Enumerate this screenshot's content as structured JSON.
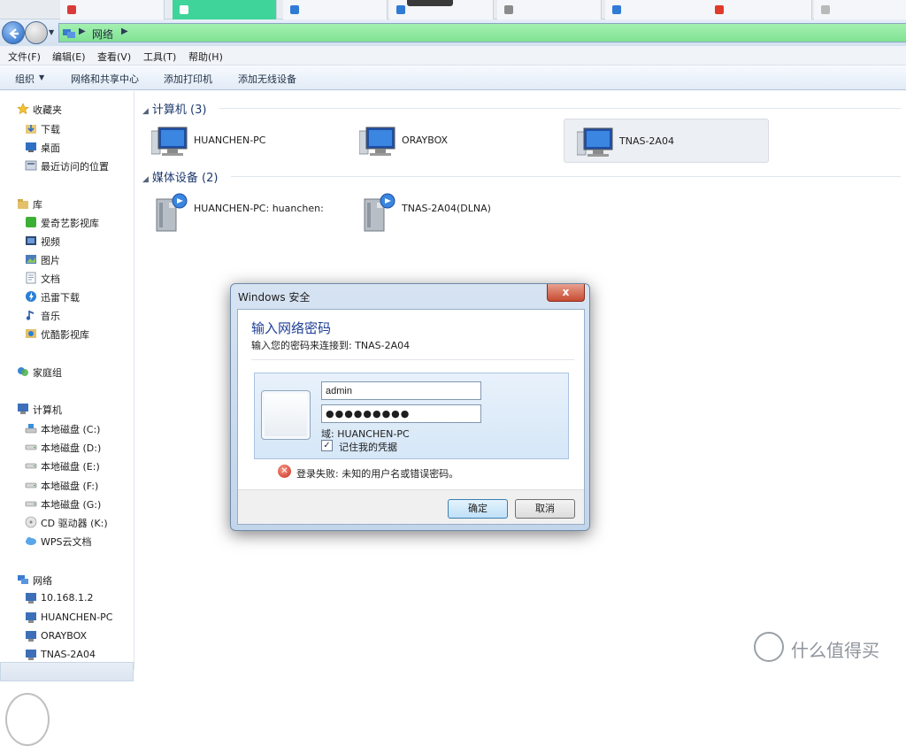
{
  "address": {
    "crumb": "网络"
  },
  "menubar": [
    "文件(F)",
    "编辑(E)",
    "查看(V)",
    "工具(T)",
    "帮助(H)"
  ],
  "toolbar": {
    "organize": "组织",
    "network_center": "网络和共享中心",
    "add_printer": "添加打印机",
    "add_wireless": "添加无线设备"
  },
  "sidebar": {
    "favorites": "收藏夹",
    "fav_items": [
      "下载",
      "桌面",
      "最近访问的位置"
    ],
    "libraries": "库",
    "lib_items": [
      "爱奇艺影视库",
      "视频",
      "图片",
      "文档",
      "迅雷下载",
      "音乐",
      "优酷影视库"
    ],
    "homegroup": "家庭组",
    "computer": "计算机",
    "drives": [
      "本地磁盘 (C:)",
      "本地磁盘 (D:)",
      "本地磁盘 (E:)",
      "本地磁盘 (F:)",
      "本地磁盘 (G:)",
      "CD 驱动器 (K:)",
      "WPS云文档"
    ],
    "network": "网络",
    "net_items": [
      "10.168.1.2",
      "HUANCHEN-PC",
      "ORAYBOX",
      "TNAS-2A04"
    ]
  },
  "content": {
    "computers_group": "计算机 (3)",
    "computers": [
      "HUANCHEN-PC",
      "ORAYBOX",
      "TNAS-2A04"
    ],
    "media_group": "媒体设备 (2)",
    "media": [
      "HUANCHEN-PC: huanchen:",
      "TNAS-2A04(DLNA)"
    ]
  },
  "dialog": {
    "title": "Windows 安全",
    "close": "x",
    "heading": "输入网络密码",
    "subtitle": "输入您的密码来连接到: TNAS-2A04",
    "username": "admin",
    "password": "●●●●●●●●●",
    "domain": "域: HUANCHEN-PC",
    "remember": "记住我的凭据",
    "remember_checked": "✓",
    "error_icon": "✕",
    "error": "登录失败: 未知的用户名或错误密码。",
    "ok": "确定",
    "cancel": "取消"
  },
  "watermark": "什么值得买",
  "colors": {
    "address_bar": "#7fe293",
    "dialog_heading": "#1e3e96",
    "selected_item": "#eceff3",
    "error_icon": "#c82c1c"
  }
}
